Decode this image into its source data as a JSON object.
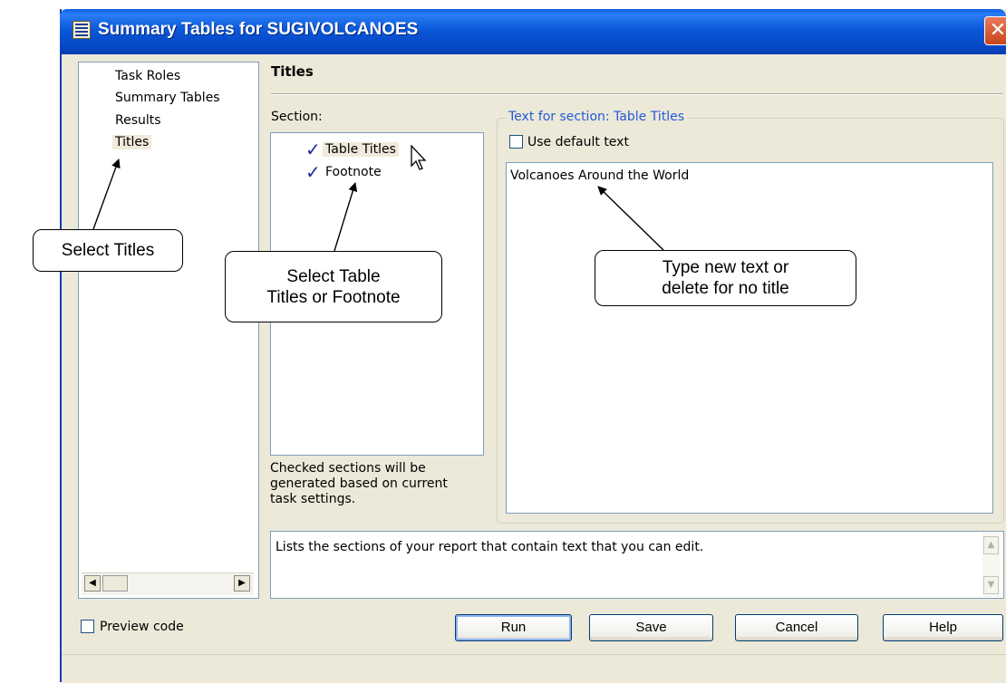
{
  "window": {
    "title": "Summary Tables for SUGIVOLCANOES",
    "close_glyph": "✕"
  },
  "nav": {
    "items": [
      {
        "label": "Task Roles"
      },
      {
        "label": "Summary Tables"
      },
      {
        "label": "Results"
      },
      {
        "label": "Titles",
        "selected": true
      }
    ]
  },
  "page": {
    "heading": "Titles"
  },
  "section": {
    "label": "Section:",
    "items": [
      {
        "label": "Table Titles",
        "checked": true,
        "selected": true
      },
      {
        "label": "Footnote",
        "checked": true
      }
    ],
    "note": "Checked sections will be\ngenerated based on current\ntask settings."
  },
  "text_group": {
    "legend": "Text for section: Table Titles",
    "use_default_label": "Use default text",
    "use_default_checked": false,
    "text_value": "Volcanoes Around the World"
  },
  "help_text": "Lists the sections of your report that contain text that you can edit.",
  "footer": {
    "preview_label": "Preview code",
    "preview_checked": false,
    "buttons": {
      "run": "Run",
      "save": "Save",
      "cancel": "Cancel",
      "help": "Help"
    }
  },
  "callouts": {
    "select_titles": "Select Titles",
    "select_table_titles": "Select Table\nTitles or Footnote",
    "type_new_text": "Type new text or\ndelete for no title"
  },
  "icons": {
    "check": "check-icon",
    "cursor": "mouse-pointer-icon",
    "app": "table-icon",
    "close": "close-icon"
  },
  "colors": {
    "titlebar": "#0b58d8",
    "legend_text": "#2458d8",
    "dialog_bg": "#ece9d8",
    "close": "#c8461c"
  }
}
